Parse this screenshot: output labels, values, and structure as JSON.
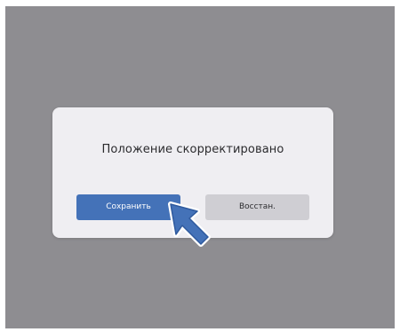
{
  "dialog": {
    "message": "Положение скорректировано",
    "save_label": "Сохранить",
    "restore_label": "Восстан."
  },
  "colors": {
    "backdrop": "#8e8d91",
    "dialog_bg": "#efeef2",
    "primary_button": "#4472b8",
    "secondary_button": "#cfced3",
    "pointer_fill": "#4472b8"
  },
  "icons": {
    "pointer": "arrow-pointer-icon"
  }
}
